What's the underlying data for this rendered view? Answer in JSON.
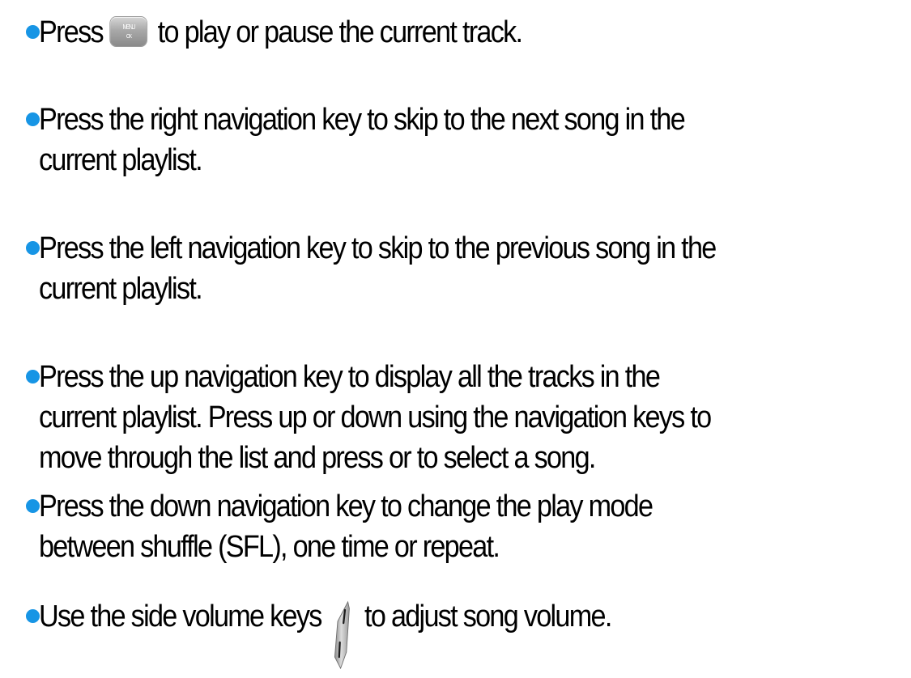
{
  "items": [
    {
      "line1_before": "Press",
      "line1_after": "to play or pause the current track.",
      "icon": "menu-ok-key-icon"
    },
    {
      "line1": "Press the right navigation key to skip to the next song in the",
      "line2": "current playlist."
    },
    {
      "line1": "Press the left navigation key to skip to the previous song in the",
      "line2": "current playlist."
    },
    {
      "line1": "Press the up navigation key to display all the tracks in the",
      "line2": "current playlist. Press up or down using the navigation keys to",
      "line3": "move through the list and press or to select a song."
    },
    {
      "line1": "Press the down navigation key to change the play mode",
      "line2": "between shuffle (SFL), one time or repeat."
    },
    {
      "line1_before": "Use the side volume keys",
      "line1_after": "to adjust song volume.",
      "icon": "side-volume-key-icon"
    }
  ],
  "colors": {
    "bullet": "#1795e5",
    "text": "#000000"
  }
}
